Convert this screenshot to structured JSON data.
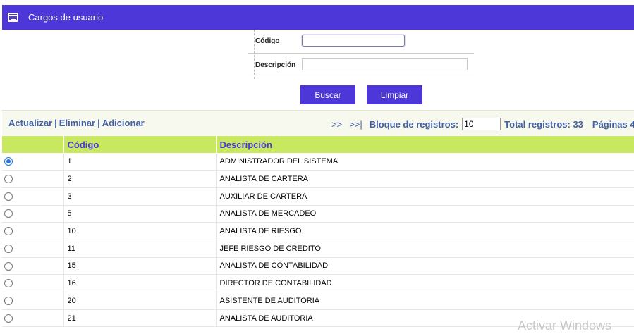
{
  "header": {
    "title": "Cargos de usuario",
    "icon": "window-icon"
  },
  "filters": {
    "codigo_label": "Código",
    "codigo_value": "",
    "descripcion_label": "Descripción",
    "descripcion_value": ""
  },
  "buttons": {
    "buscar": "Buscar",
    "limpiar": "Limpiar"
  },
  "toolbar": {
    "actualizar": "Actualizar",
    "eliminar": "Eliminar",
    "adicionar": "Adicionar",
    "separator": "|",
    "next": ">>",
    "last": ">>|",
    "bloque_label": "Bloque de registros:",
    "bloque_value": "10",
    "total_label": "Total registros: 33",
    "paginas_label": "Páginas 4"
  },
  "table": {
    "columns": [
      "",
      "Código",
      "Descripción"
    ],
    "rows": [
      {
        "selected": true,
        "codigo": "1",
        "descripcion": "ADMINISTRADOR DEL SISTEMA"
      },
      {
        "selected": false,
        "codigo": "2",
        "descripcion": "ANALISTA DE CARTERA"
      },
      {
        "selected": false,
        "codigo": "3",
        "descripcion": "AUXILIAR DE CARTERA"
      },
      {
        "selected": false,
        "codigo": "5",
        "descripcion": "ANALISTA DE MERCADEO"
      },
      {
        "selected": false,
        "codigo": "10",
        "descripcion": "ANALISTA DE RIESGO"
      },
      {
        "selected": false,
        "codigo": "11",
        "descripcion": "JEFE RIESGO DE CREDITO"
      },
      {
        "selected": false,
        "codigo": "15",
        "descripcion": "ANALISTA DE CONTABILIDAD"
      },
      {
        "selected": false,
        "codigo": "16",
        "descripcion": "DIRECTOR DE CONTABILIDAD"
      },
      {
        "selected": false,
        "codigo": "20",
        "descripcion": "ASISTENTE DE AUDITORIA"
      },
      {
        "selected": false,
        "codigo": "21",
        "descripcion": "ANALISTA DE AUDITORIA"
      }
    ]
  },
  "watermark": "Activar Windows",
  "colors": {
    "header": "#4d37d9",
    "table_header": "#c8e860",
    "link": "#4260a8"
  }
}
